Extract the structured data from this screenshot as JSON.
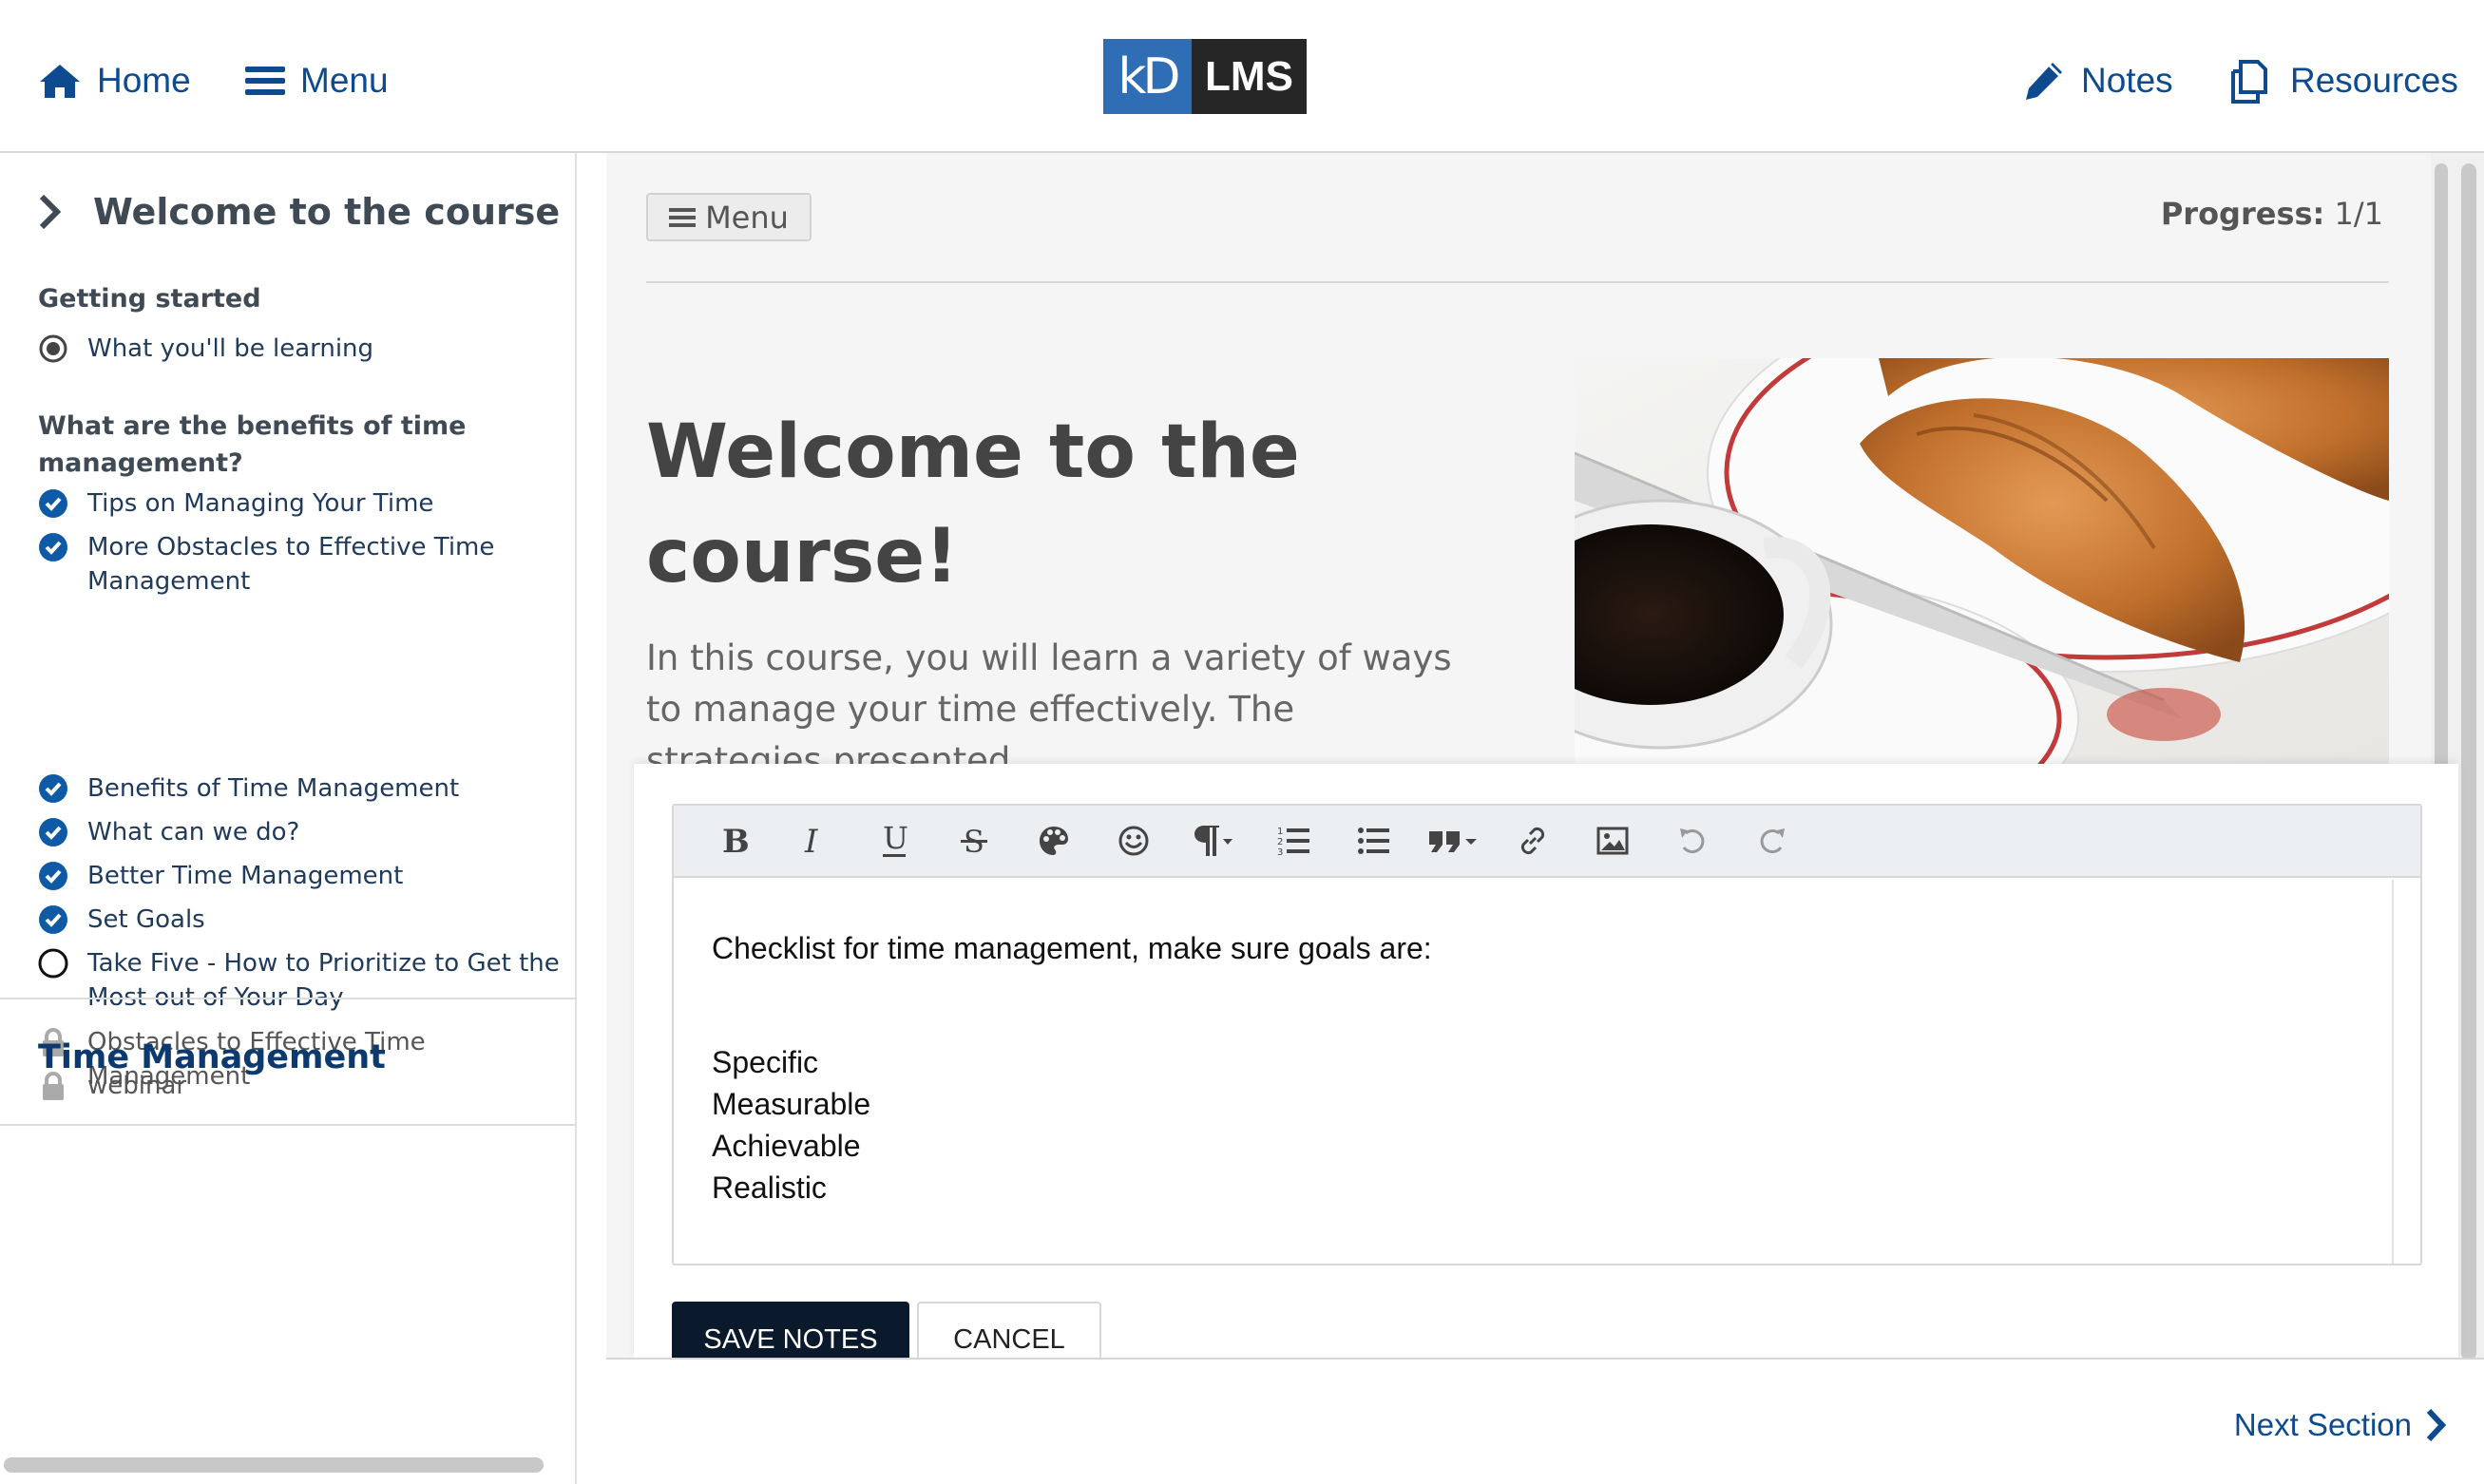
{
  "header": {
    "home_label": "Home",
    "menu_label": "Menu",
    "logo_left": "kD",
    "logo_right": "LMS",
    "notes_label": "Notes",
    "resources_label": "Resources"
  },
  "sidebar": {
    "current_title": "Welcome to the course",
    "groups": [
      {
        "title": "Getting started",
        "items": [
          {
            "label": "What you'll be learning",
            "status": "current"
          }
        ]
      },
      {
        "title": "What are the benefits of time management?",
        "items": [
          {
            "label": "Tips on Managing Your Time",
            "status": "complete"
          },
          {
            "label": "More Obstacles to Effective Time Management",
            "status": "complete"
          },
          {
            "label": "Benefits of Time Management",
            "status": "complete"
          },
          {
            "label": "What can we do?",
            "status": "complete"
          },
          {
            "label": "Better Time Management",
            "status": "complete"
          },
          {
            "label": "Set Goals",
            "status": "complete"
          },
          {
            "label": "Take Five - How to Prioritize to Get the Most out of Your Day",
            "status": "incomplete"
          },
          {
            "label": "Obstacles to Effective Time Management",
            "status": "locked"
          },
          {
            "label": "webinar",
            "status": "locked"
          }
        ]
      }
    ],
    "section_title": "Time Management"
  },
  "main": {
    "menu_button_label": "Menu",
    "progress_label": "Progress:",
    "progress_value": "1/1",
    "heading": "Welcome to the course!",
    "lead": "In this course, you will learn a variety of ways to manage your time effectively. The strategies presented"
  },
  "notes": {
    "toolbar": [
      "bold-icon",
      "italic-icon",
      "underline-icon",
      "strikethrough-icon",
      "palette-icon",
      "emoji-icon",
      "paragraph-icon",
      "ordered-list-icon",
      "bullet-list-icon",
      "quote-icon",
      "link-icon",
      "image-icon",
      "undo-icon",
      "redo-icon"
    ],
    "intro": "Checklist for time management, make sure goals are:",
    "items": [
      "Specific",
      "Measurable",
      "Achievable",
      "Realistic"
    ],
    "save_label": "SAVE NOTES",
    "cancel_label": "CANCEL"
  },
  "footer": {
    "next_label": "Next Section"
  },
  "colors": {
    "brand_blue": "#0d4a8f",
    "check_blue": "#0e5aa7",
    "save_bg": "#0a1a2c"
  }
}
